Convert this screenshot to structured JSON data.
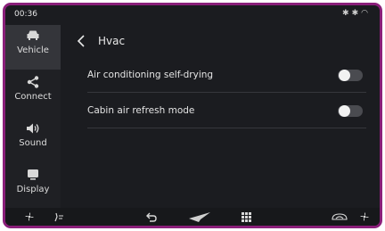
{
  "status": {
    "time": "00:36",
    "icons": [
      "bluetooth-icon",
      "bluetooth-icon",
      "wifi-icon"
    ]
  },
  "sidebar": {
    "items": [
      {
        "label": "Vehicle",
        "icon": "car-icon",
        "active": true
      },
      {
        "label": "Connect",
        "icon": "share-icon",
        "active": false
      },
      {
        "label": "Sound",
        "icon": "speaker-icon",
        "active": false
      },
      {
        "label": "Display",
        "icon": "display-icon",
        "active": false
      }
    ]
  },
  "header": {
    "title": "Hvac"
  },
  "settings": [
    {
      "label": "Air conditioning self-drying",
      "enabled": false
    },
    {
      "label": "Cabin air refresh mode",
      "enabled": false
    }
  ],
  "bottombar": {
    "icons": [
      "fan-icon",
      "seat-airflow-icon",
      "back-icon",
      "navigation-icon",
      "apps-grid-icon",
      "recirculation-icon",
      "fan-icon"
    ]
  },
  "colors": {
    "frame": "#8a1f7a",
    "background": "#1b1c20",
    "active_tab": "#34353a"
  }
}
